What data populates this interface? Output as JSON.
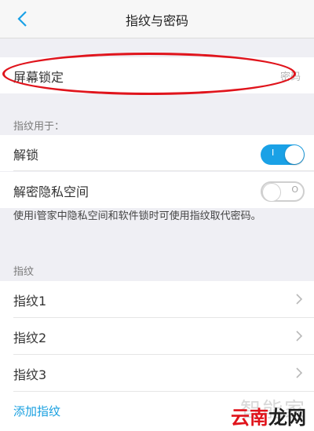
{
  "header": {
    "title": "指纹与密码",
    "back_icon": "chevron-left-icon"
  },
  "screen_lock": {
    "label": "屏幕锁定",
    "value": "密码"
  },
  "usage_section": {
    "title": "指纹用于：",
    "items": [
      {
        "label": "解锁",
        "toggle": "on",
        "mark": "I"
      },
      {
        "label": "解密隐私空间",
        "toggle": "off",
        "mark": "O"
      }
    ]
  },
  "note": "使用i管家中隐私空间和软件锁时可使用指纹取代密码。",
  "fingerprint_section": {
    "title": "指纹",
    "items": [
      {
        "label": "指纹1"
      },
      {
        "label": "指纹2"
      },
      {
        "label": "指纹3"
      }
    ],
    "add_label": "添加指纹"
  },
  "watermark": {
    "top": "智能家",
    "bottom_red": "云南",
    "bottom_dark": "龙网"
  },
  "colors": {
    "accent": "#1aa1e6",
    "annotation": "#e0141c"
  }
}
